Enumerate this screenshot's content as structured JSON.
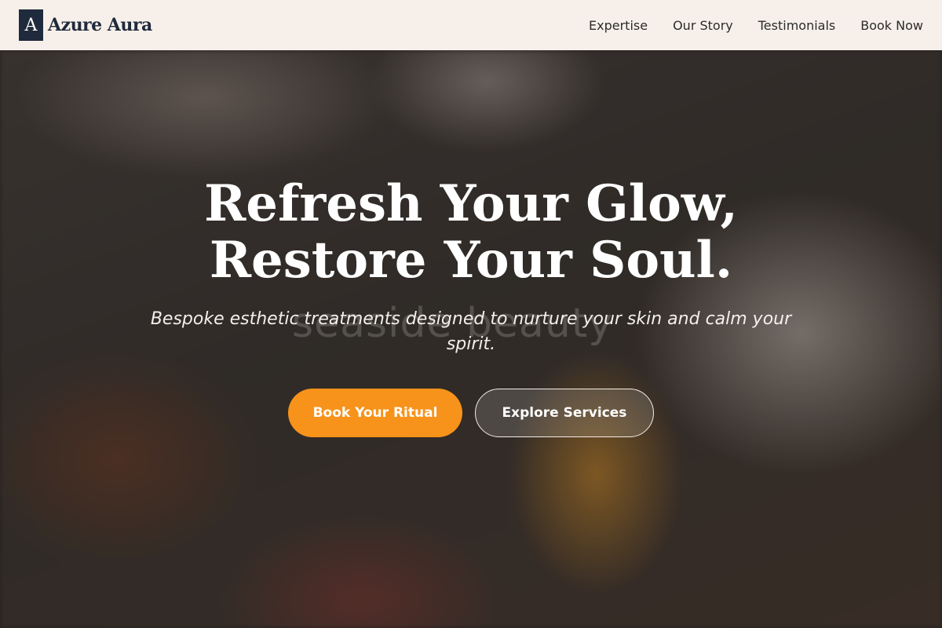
{
  "brand": {
    "mark": "A",
    "name": "Azure Aura"
  },
  "nav": [
    {
      "label": "Expertise"
    },
    {
      "label": "Our Story"
    },
    {
      "label": "Testimonials"
    },
    {
      "label": "Book Now"
    }
  ],
  "hero": {
    "title_line1": "Refresh Your Glow,",
    "title_line2": "Restore Your Soul.",
    "subtitle": "Bespoke esthetic treatments designed to nurture your skin and calm your spirit.",
    "watermark": "seaside beauty",
    "primary_cta": "Book Your Ritual",
    "secondary_cta": "Explore Services"
  },
  "colors": {
    "accent": "#f7931a",
    "brand_navy": "#1f2a3c",
    "header_bg": "#f7f0ea"
  }
}
